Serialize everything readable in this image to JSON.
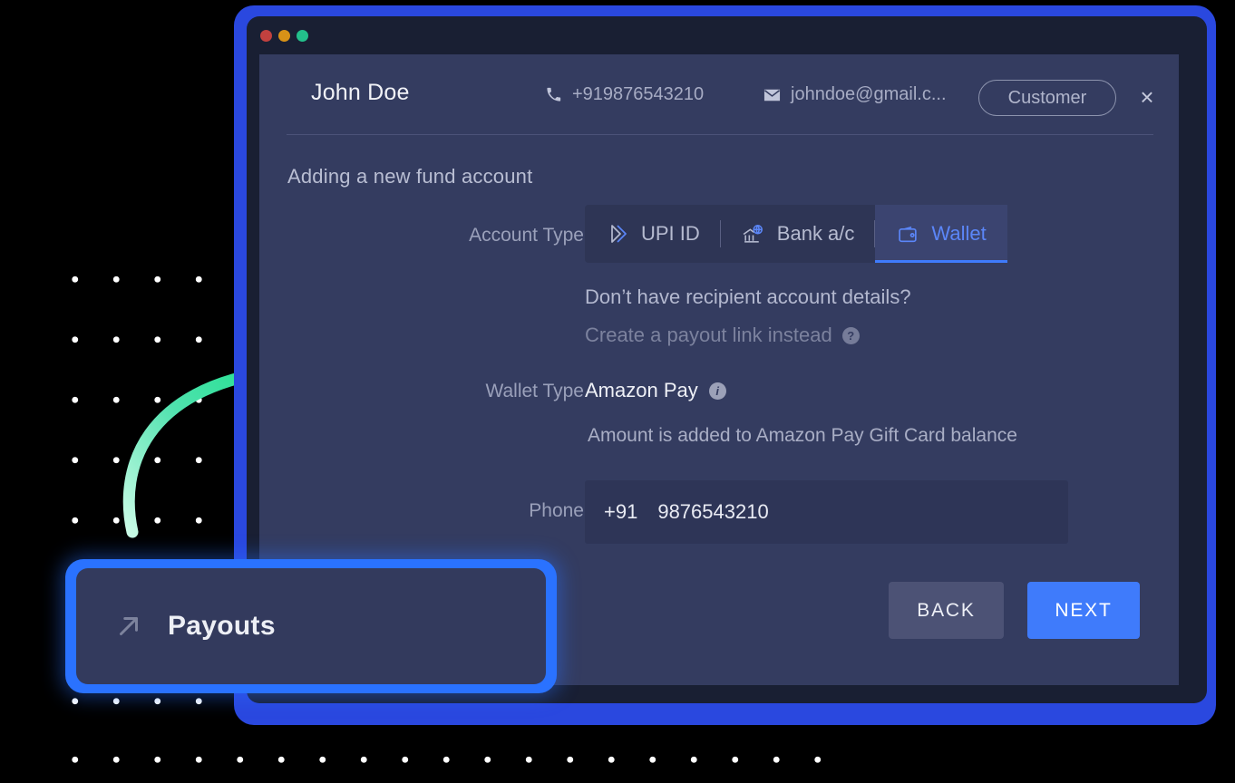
{
  "window": {
    "traffic_lights": [
      "close-red",
      "minimize-yellow",
      "maximize-green"
    ],
    "frame_color": "#2a48df",
    "chrome_color": "#191f33",
    "panel_color": "#343c60"
  },
  "header": {
    "customer_name": "John Doe",
    "phone_icon": "phone-icon",
    "phone": "+919876543210",
    "email_icon": "mail-icon",
    "email": "johndoe@gmail.c...",
    "tag_label": "Customer",
    "close_icon": "×"
  },
  "form": {
    "title": "Adding a new fund account",
    "account_type": {
      "label": "Account Type",
      "tabs": [
        {
          "label": "UPI ID",
          "icon": "upi-icon",
          "active": false
        },
        {
          "label": "Bank a/c",
          "icon": "bank-icon",
          "active": false
        },
        {
          "label": "Wallet",
          "icon": "wallet-icon",
          "active": true
        }
      ],
      "active_color": "#3f7bfb"
    },
    "payout_link": {
      "question": "Don’t have recipient account details?",
      "link_text": "Create a payout link instead",
      "help_icon": "?"
    },
    "wallet_type": {
      "label": "Wallet Type",
      "value": "Amazon Pay",
      "info_icon": "i",
      "note": "Amount is added to Amazon Pay Gift Card balance"
    },
    "phone": {
      "label": "Phone",
      "country_code": "+91",
      "number": "9876543210"
    },
    "buttons": {
      "back": "BACK",
      "next": "NEXT"
    }
  },
  "callout": {
    "label": "Payouts",
    "icon": "arrow-up-right-icon",
    "border_color": "#2a72ff"
  },
  "decor": {
    "arrow_icon": "curved-green-arrow",
    "arrow_color": "#3ddc9b",
    "dot_color": "#ffffff"
  }
}
